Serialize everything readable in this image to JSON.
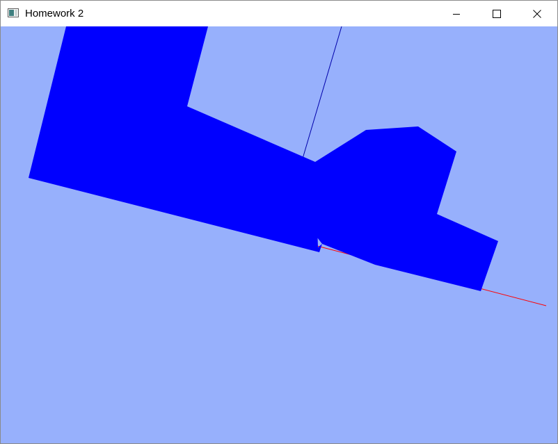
{
  "window": {
    "title": "Homework 2",
    "icon": "app-window-icon",
    "controls": {
      "minimize_icon": "minimize-icon",
      "maximize_icon": "maximize-icon",
      "close_icon": "close-icon"
    }
  },
  "scene": {
    "background_color": "#97b0fc",
    "model_color": "#0000ff",
    "axis_colors": {
      "x_axis": "#ff0000",
      "y_axis": "#0000aa"
    }
  }
}
